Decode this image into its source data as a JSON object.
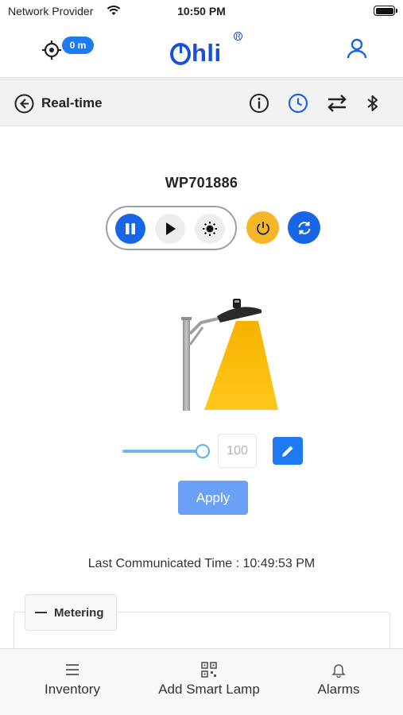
{
  "status_bar": {
    "carrier": "Network Provider",
    "time": "10:50 PM"
  },
  "header": {
    "gps_badge": "0 m",
    "logo_text": "hli",
    "logo_mark": "R",
    "brand_color": "#1a4fd8"
  },
  "toolbar": {
    "title": "Real-time",
    "icons": [
      "info-icon",
      "clock-icon",
      "transfer-icon",
      "bluetooth-icon"
    ],
    "active_icon": "clock-icon"
  },
  "device": {
    "id": "WP701886",
    "controls": [
      "pause-icon",
      "play-icon",
      "brightness-icon"
    ],
    "extra_buttons": [
      "power-icon",
      "sync-icon"
    ]
  },
  "dimming": {
    "slider_value": 100,
    "slider_max": 100,
    "input_value": "100",
    "apply_label": "Apply"
  },
  "last_communicated": "Last Communicated Time : 10:49:53 PM",
  "metering": {
    "label": "Metering"
  },
  "bottom_nav": [
    {
      "label": "Inventory",
      "icon": "menu-icon"
    },
    {
      "label": "Add Smart Lamp",
      "icon": "qr-code-icon"
    },
    {
      "label": "Alarms",
      "icon": "bell-icon"
    }
  ],
  "colors": {
    "primary": "#1766e6",
    "power": "#f4b728",
    "apply": "#6ba0f7",
    "lamp_light": "#f9b800"
  }
}
